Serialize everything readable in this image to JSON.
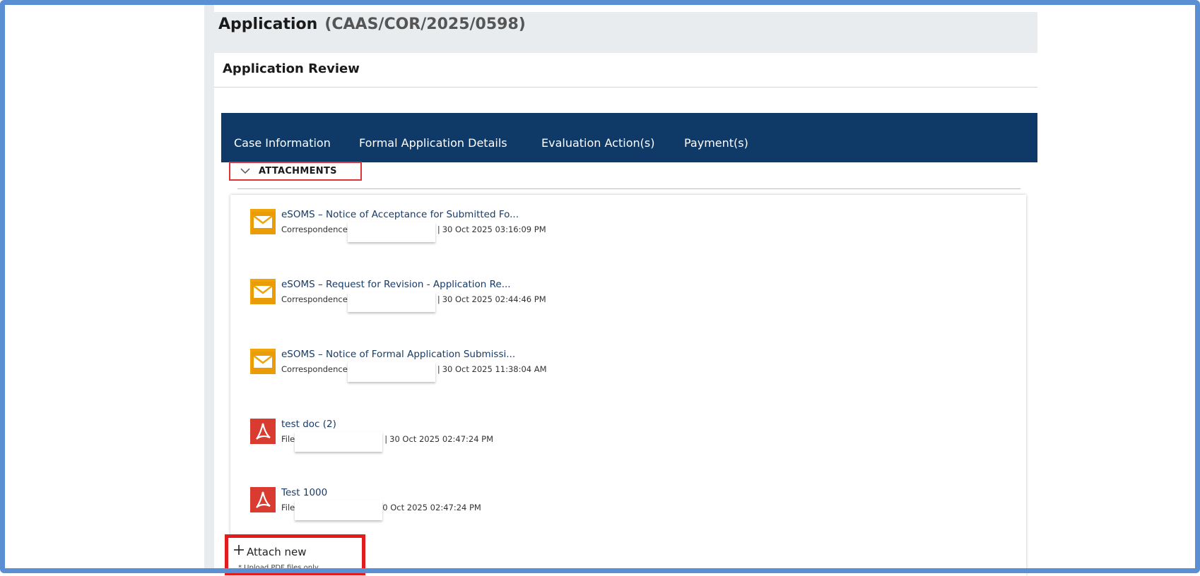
{
  "header": {
    "title": "Application",
    "reference": "(CAAS/COR/2025/0598)"
  },
  "review": {
    "title": "Application Review"
  },
  "tabs": [
    {
      "label": "Case Information"
    },
    {
      "label": "Formal Application Details"
    },
    {
      "label": "Evaluation Action(s)"
    },
    {
      "label": "Payment(s)"
    }
  ],
  "attachments": {
    "header": "ATTACHMENTS",
    "items": [
      {
        "icon": "mail-icon",
        "name": "eSOMS – Notice of Acceptance for Submitted Fo...",
        "type": "Correspondence",
        "date": "30 Oct 2025 03:16:09 PM"
      },
      {
        "icon": "mail-icon",
        "name": "eSOMS – Request for Revision - Application Re...",
        "type": "Correspondence",
        "date": "30 Oct 2025 02:44:46 PM"
      },
      {
        "icon": "mail-icon",
        "name": "eSOMS – Notice of Formal Application Submissi...",
        "type": "Correspondence",
        "date": "30 Oct 2025 11:38:04 AM"
      },
      {
        "icon": "pdf-icon",
        "name": "test doc (2)",
        "type": "File",
        "date": "30 Oct 2025 02:47:24 PM"
      },
      {
        "icon": "pdf-icon",
        "name": "Test 1000",
        "type": "File",
        "date": "0 Oct 2025 02:47:24 PM"
      }
    ],
    "attach_new": "Attach new",
    "hint": "* Upload PDF files only"
  },
  "colors": {
    "tabbar": "#0f3a68",
    "highlight": "#e21c1c",
    "mail_icon": "#f0a30a",
    "pdf_icon": "#d93b30"
  }
}
